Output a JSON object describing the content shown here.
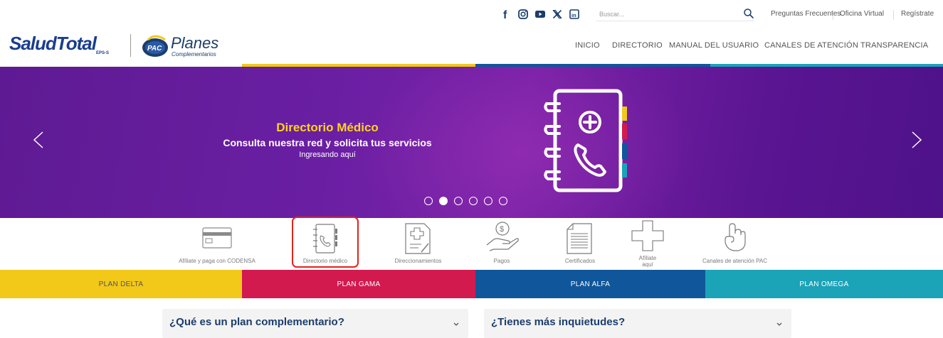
{
  "topbar": {
    "social": [
      {
        "name": "facebook-icon",
        "glyph": "f"
      },
      {
        "name": "instagram-icon",
        "glyph": ""
      },
      {
        "name": "youtube-icon",
        "glyph": ""
      },
      {
        "name": "x-twitter-icon",
        "glyph": "𝕏"
      },
      {
        "name": "linkedin-icon",
        "glyph": "in"
      }
    ],
    "search_placeholder": "Buscar...",
    "links": [
      "Preguntas Frecuentes",
      "Oficina Virtual",
      "Regístrate"
    ]
  },
  "header": {
    "logo_main": "SaludTotal",
    "logo_suffix": "EPS-S",
    "logo_pac_badge": "PAC",
    "logo_pac_title": "Planes",
    "logo_pac_subtitle": "Complementarios",
    "nav": [
      "INICIO",
      "DIRECTORIO",
      "MANUAL DEL USUARIO",
      "CANALES DE ATENCIÓN",
      "TRANSPARENCIA"
    ]
  },
  "colors": {
    "yellow": "#f2c819",
    "magenta": "#d21a4f",
    "blue": "#10569a",
    "teal": "#1ba3b8",
    "navy": "#1b3d6b"
  },
  "hero": {
    "title": "Directorio Médico",
    "subtitle": "Consulta nuestra red y solicita tus servicios",
    "link": "Ingresando aquí",
    "dots_total": 6,
    "active_dot": 2
  },
  "quick_access": [
    {
      "label": "Afíliate y paga con CODENSA",
      "icon": "credit-card-icon"
    },
    {
      "label": "Directorio médico",
      "icon": "phone-directory-icon"
    },
    {
      "label": "Direccionamientos",
      "icon": "medical-document-icon"
    },
    {
      "label": "Pagos",
      "icon": "payment-hand-icon"
    },
    {
      "label": "Certificados",
      "icon": "certificate-document-icon"
    },
    {
      "label_line1": "Afíliate",
      "label_line2": "aquí",
      "icon": "plus-cross-icon"
    },
    {
      "label": "Canales de atención PAC",
      "icon": "hand-pointer-icon"
    }
  ],
  "plans": [
    "PLAN DELTA",
    "PLAN GAMA",
    "PLAN ALFA",
    "PLAN OMEGA"
  ],
  "faq": [
    "¿Qué es un plan complementario?",
    "¿Tienes más inquietudes?"
  ]
}
